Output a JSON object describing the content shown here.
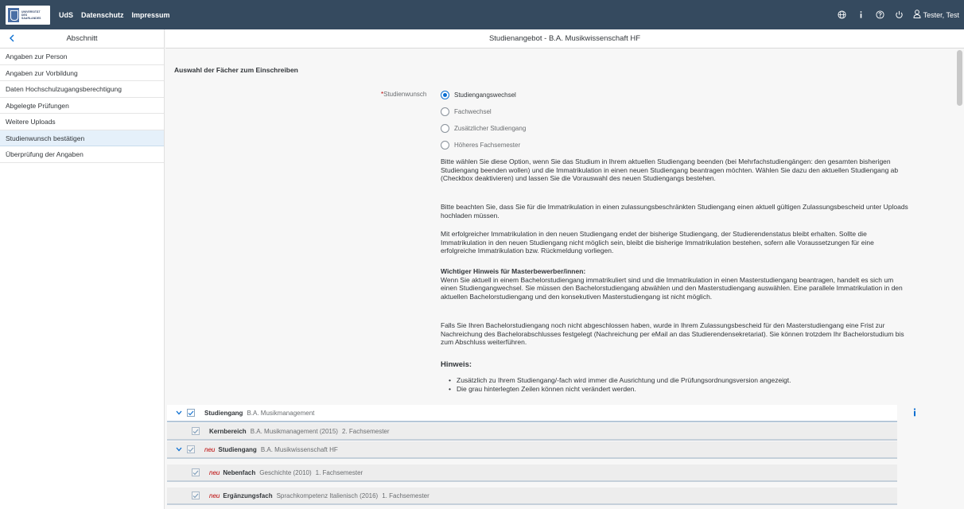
{
  "topbar": {
    "logo_text": [
      "UNIVERSITÄT",
      "DES",
      "SAARLANDES"
    ],
    "links": [
      "UdS",
      "Datenschutz",
      "Impressum"
    ],
    "user_name": "Tester, Test",
    "icons": [
      "globe-icon",
      "info-icon",
      "help-icon",
      "power-icon",
      "user-icon"
    ]
  },
  "sidebar": {
    "title": "Abschnitt",
    "items": [
      {
        "label": "Angaben zur Person"
      },
      {
        "label": "Angaben zur Vorbildung"
      },
      {
        "label": "Daten Hochschulzugangsberechtigung"
      },
      {
        "label": "Abgelegte Prüfungen"
      },
      {
        "label": "Weitere Uploads"
      },
      {
        "label": "Studienwunsch bestätigen"
      },
      {
        "label": "Überprüfung der Angaben"
      }
    ]
  },
  "main": {
    "header_title": "Studienangebot - B.A. Musikwissenschaft HF",
    "section_title": "Auswahl der Fächer zum Einschreiben",
    "wish_label": "Studienwunsch",
    "wish_required": "*",
    "options": [
      {
        "label": "Studiengangswechsel",
        "selected": true
      },
      {
        "label": "Fachwechsel",
        "selected": false
      },
      {
        "label": "Zusätzlicher Studiengang",
        "selected": false
      },
      {
        "label": "Höheres Fachsemester",
        "selected": false
      }
    ],
    "paragraphs": [
      "Bitte wählen Sie diese Option, wenn Sie das Studium in Ihrem aktuellen Studiengang beenden (bei Mehrfachstudiengängen: den gesamten bisherigen Studiengang beenden wollen) und die Immatrikulation in einen neuen Studiengang beantragen möchten. Wählen Sie dazu den aktuellen Studiengang ab (Checkbox deaktivieren) und lassen Sie die Vorauswahl des neuen Studiengangs bestehen.",
      "Bitte beachten Sie, dass Sie für die Immatrikulation in einen zulassungsbeschränkten Studiengang einen aktuell gültigen Zulassungsbescheid unter Uploads hochladen müssen.",
      "Mit erfolgreicher Immatrikulation in den neuen Studiengang endet der bisherige Studiengang, der Studierendenstatus bleibt erhalten. Sollte die Immatrikulation in den neuen Studiengang nicht möglich sein, bleibt die bisherige Immatrikulation bestehen, sofern alle Voraussetzungen für eine erfolgreiche Immatrikulation bzw. Rückmeldung vorliegen.",
      "Wenn Sie aktuell in einem Bachelorstudiengang immatrikuliert sind und die Immatrikulation in einen Masterstudiengang beantragen, handelt es sich um einen Studiengangwechsel. Sie müssen den Bachelorstudiengang abwählen und den Masterstudiengang auswählen. Eine parallele Immatrikulation in den aktuellen Bachelorstudiengang und den konsekutiven Masterstudiengang ist nicht möglich.",
      "Falls Sie Ihren Bachelorstudiengang noch nicht abgeschlossen haben, wurde in Ihrem Zulassungsbescheid für den Masterstudiengang eine Frist zur Nachreichung des Bachelorabschlusses festgelegt (Nachreichung per eMail an das Studierendensekretariat). Sie können trotzdem Ihr Bachelorstudium bis zum Abschluss weiterführen."
    ],
    "master_heading": "Wichtiger Hinweis für Masterbewerber/innen:",
    "hinweis_title": "Hinweis:",
    "hinweis_items": [
      "Zusätzlich zu Ihrem Studiengang/-fach wird immer die Ausrichtung und die Prüfungsordnungsversion angezeigt.",
      "Die grau hinterlegten Zeilen können nicht verändert werden."
    ],
    "tree_rows": [
      {
        "neu": "",
        "key": "Studiengang",
        "value": "B.A. Musikmanagement",
        "extra": ""
      },
      {
        "neu": "",
        "key": "Kernbereich",
        "value": "B.A. Musikmanagement (2015)",
        "extra": "2. Fachsemester"
      },
      {
        "neu": "neu",
        "key": "Studiengang",
        "value": "B.A. Musikwissenschaft HF",
        "extra": ""
      },
      {
        "neu": "neu",
        "key": "Nebenfach",
        "value": "Geschichte (2010)",
        "extra": "1. Fachsemester"
      },
      {
        "neu": "neu",
        "key": "Ergänzungsfach",
        "value": "Sprachkompetenz Italienisch (2016)",
        "extra": "1. Fachsemester"
      }
    ]
  },
  "colors": {
    "shell": "#354a5f",
    "accent": "#0a6ed1",
    "required": "#bb0000",
    "active_nav": "#e5f0fa"
  }
}
